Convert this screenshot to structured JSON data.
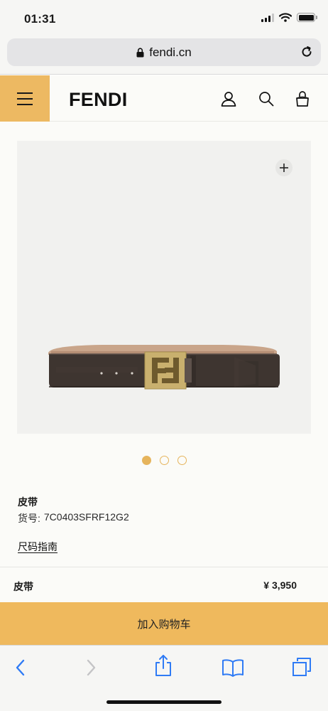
{
  "status_bar": {
    "time": "01:31"
  },
  "browser": {
    "url": "fendi.cn"
  },
  "header": {
    "logo": "FENDI"
  },
  "product": {
    "name": "皮带",
    "sku_label": "货号:",
    "sku": "7C0403SFRF12G2",
    "size_guide": "尺码指南",
    "image_count": 3,
    "active_image": 1
  },
  "sticky_bar": {
    "name": "皮带",
    "price": "¥ 3,950"
  },
  "cta": {
    "add_to_cart": "加入购物车"
  },
  "colors": {
    "accent": "#EDB962",
    "belt": "#3E3530",
    "buckle": "#C9B06E"
  },
  "icons": [
    "lock-icon",
    "reload-icon",
    "menu-icon",
    "user-icon",
    "search-icon",
    "bag-icon",
    "plus-icon",
    "back-icon",
    "forward-icon",
    "share-icon",
    "bookmarks-icon",
    "tabs-icon"
  ]
}
